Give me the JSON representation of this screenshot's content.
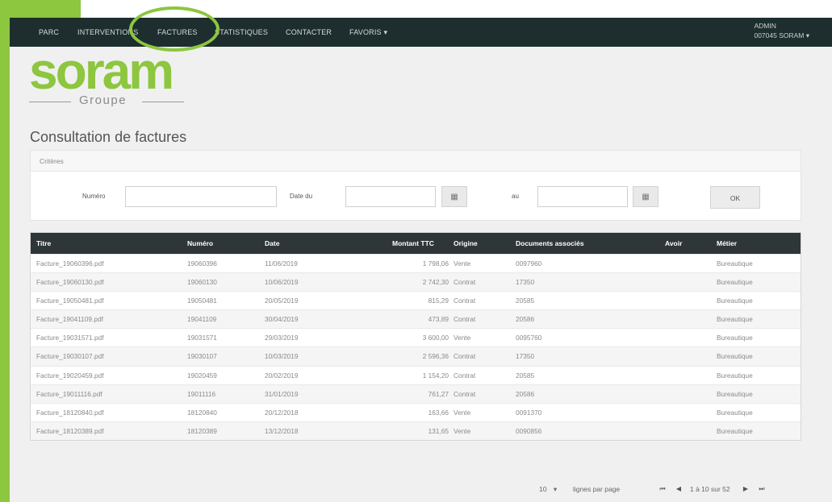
{
  "nav": {
    "items": [
      "PARC",
      "INTERVENTIONS",
      "FACTURES",
      "STATISTIQUES",
      "CONTACTER",
      "FAVORIS ▾"
    ],
    "user_line1": "ADMIN",
    "user_line2": "007045 SORAM ▾"
  },
  "logo": {
    "name": "soram",
    "sub": "Groupe"
  },
  "page": {
    "title": "Consultation de factures"
  },
  "criteria": {
    "header": "Critères",
    "numero_label": "Numéro",
    "date_from_label": "Date du",
    "date_to_label": "au",
    "ok_label": "OK",
    "numero_value": "",
    "date_from_value": "",
    "date_to_value": ""
  },
  "table": {
    "columns": [
      "Titre",
      "Numéro",
      "Date",
      "Montant TTC",
      "Origine",
      "Documents associés",
      "Avoir",
      "Métier"
    ],
    "rows": [
      [
        "Facture_19060396.pdf",
        "19060396",
        "11/06/2019",
        "1 798,06",
        "Vente",
        "0097960",
        "",
        "Bureautique"
      ],
      [
        "Facture_19060130.pdf",
        "19060130",
        "10/06/2019",
        "2 742,30",
        "Contrat",
        "17350",
        "",
        "Bureautique"
      ],
      [
        "Facture_19050481.pdf",
        "19050481",
        "20/05/2019",
        "815,29",
        "Contrat",
        "20585",
        "",
        "Bureautique"
      ],
      [
        "Facture_19041109.pdf",
        "19041109",
        "30/04/2019",
        "473,89",
        "Contrat",
        "20586",
        "",
        "Bureautique"
      ],
      [
        "Facture_19031571.pdf",
        "19031571",
        "29/03/2019",
        "3 600,00",
        "Vente",
        "0095760",
        "",
        "Bureautique"
      ],
      [
        "Facture_19030107.pdf",
        "19030107",
        "10/03/2019",
        "2 596,36",
        "Contrat",
        "17350",
        "",
        "Bureautique"
      ],
      [
        "Facture_19020459.pdf",
        "19020459",
        "20/02/2019",
        "1 154,20",
        "Contrat",
        "20585",
        "",
        "Bureautique"
      ],
      [
        "Facture_19011116.pdf",
        "19011116",
        "31/01/2019",
        "761,27",
        "Contrat",
        "20586",
        "",
        "Bureautique"
      ],
      [
        "Facture_18120840.pdf",
        "18120840",
        "20/12/2018",
        "163,66",
        "Vente",
        "0091370",
        "",
        "Bureautique"
      ],
      [
        "Facture_18120389.pdf",
        "18120389",
        "13/12/2018",
        "131,65",
        "Vente",
        "0090856",
        "",
        "Bureautique"
      ]
    ]
  },
  "pager": {
    "per_page": "10",
    "per_page_caret": "▾",
    "per_page_label": "lignes par page",
    "range": "1 à 10 sur 52",
    "first": "⏮",
    "prev": "◀",
    "next": "▶",
    "last": "⏭"
  },
  "colors": {
    "brand_green": "#8dc63f",
    "nav_bg": "#1e2e2e",
    "table_head": "#2f3638"
  }
}
